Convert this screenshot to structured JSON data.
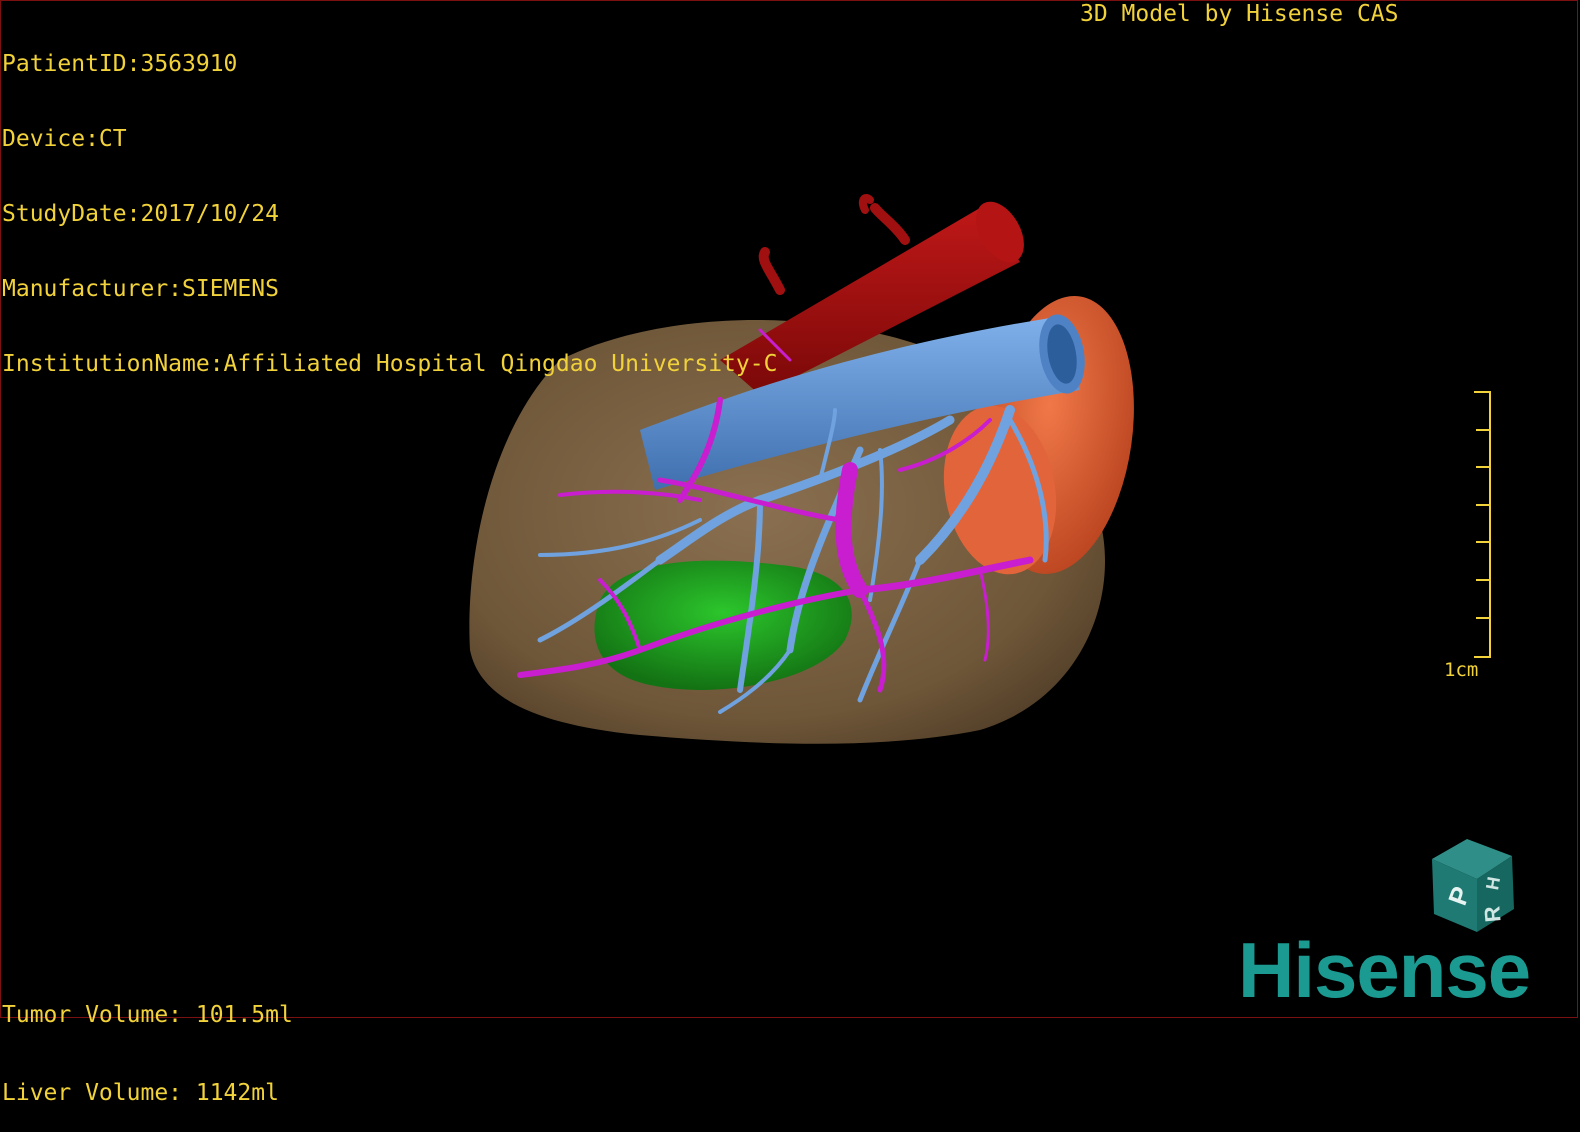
{
  "header": {
    "patient_id": "PatientID:3563910",
    "device": "Device:CT",
    "study_date": "StudyDate:2017/10/24",
    "manufacturer": "Manufacturer:SIEMENS",
    "institution": "InstitutionName:Affiliated Hospital Qingdao University-C"
  },
  "brand_title": "3D Model by Hisense CAS",
  "scale": {
    "label": "1cm"
  },
  "volumes": {
    "tumor": "Tumor Volume: 101.5ml",
    "liver": "Liver Volume: 1142ml"
  },
  "orientation_cube": {
    "labels": [
      "P",
      "H",
      "R"
    ]
  },
  "logo": {
    "text": "Hisense"
  },
  "model_colors": {
    "liver": "#7a6246",
    "aorta": "#9e1010",
    "ivc": "#5b8fd0",
    "portal_vein": "#c81ecf",
    "tumor": "#1e9e1e",
    "spleen": "#d9562d"
  }
}
